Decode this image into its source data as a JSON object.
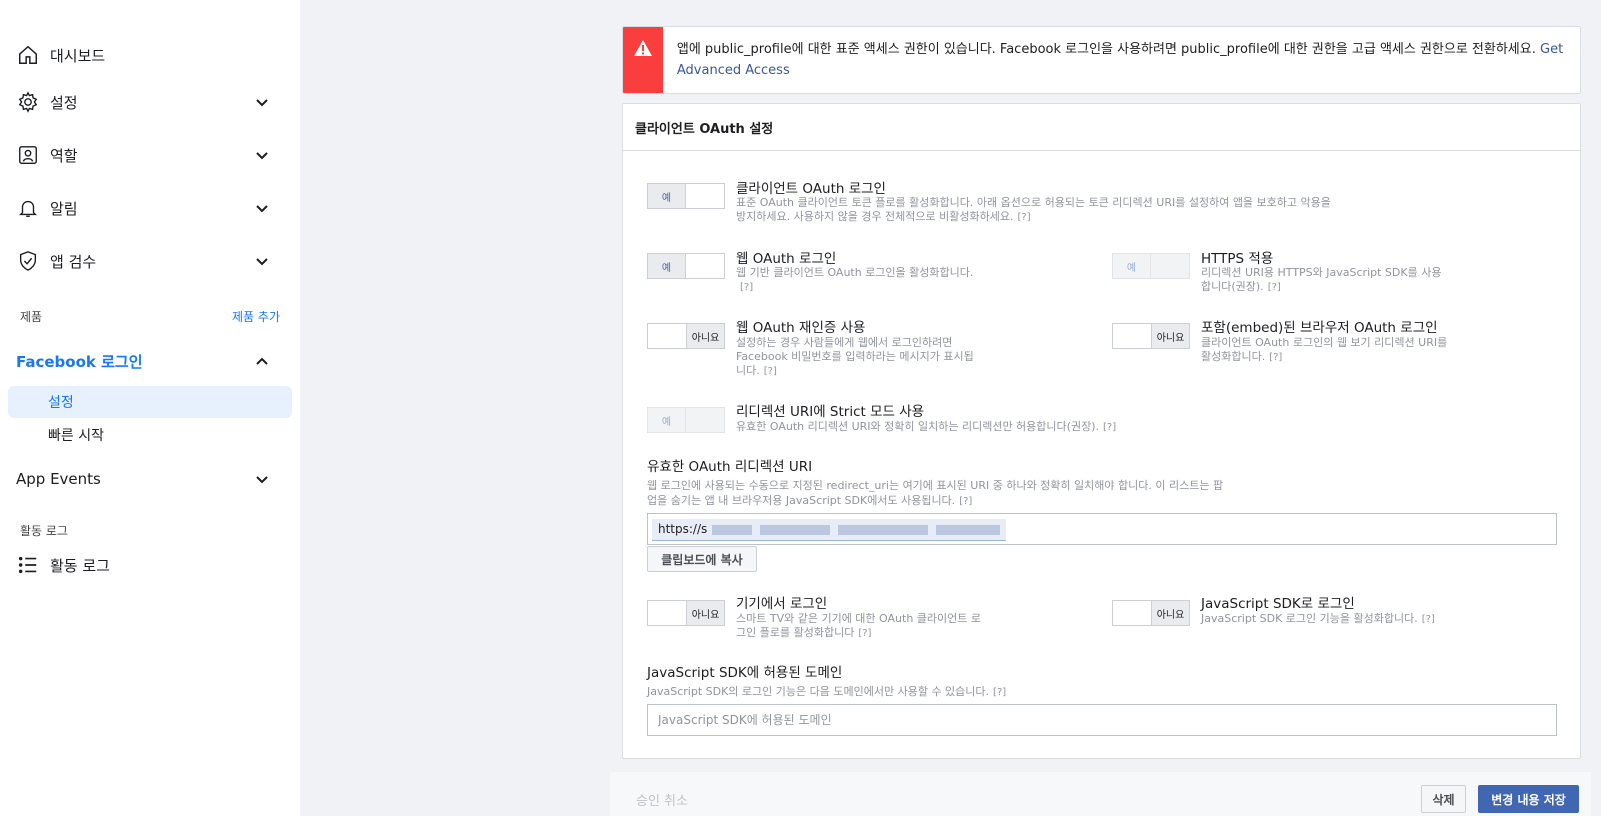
{
  "sidebar": {
    "items": [
      {
        "label": "대시보드",
        "icon": "home-icon"
      },
      {
        "label": "설정",
        "icon": "gear-icon"
      },
      {
        "label": "역할",
        "icon": "roles-icon"
      },
      {
        "label": "알림",
        "icon": "bell-icon"
      },
      {
        "label": "앱 검수",
        "icon": "shield-check-icon"
      }
    ],
    "products_label": "제품",
    "add_product_label": "제품 추가",
    "fb_login": {
      "label": "Facebook 로그인",
      "sub_items": [
        {
          "label": "설정",
          "active": true
        },
        {
          "label": "빠른 시작",
          "active": false
        }
      ]
    },
    "app_events_label": "App Events",
    "activity_section_label": "활동 로그",
    "activity_item_label": "활동 로그"
  },
  "alert": {
    "message": "앱에 public_profile에 대한 표준 액세스 권한이 있습니다. Facebook 로그인을 사용하려면 public_profile에 대한 권한을 고급 액세스 권한으로 전환하세요.",
    "link": "Get Advanced Access",
    "color": "#fa3e3e"
  },
  "panel": {
    "title": "클라이언트 OAuth 설정",
    "settings": {
      "client_oauth": {
        "title": "클라이언트 OAuth 로그인",
        "desc": "표준 OAuth 클라이언트 토큰 플로를 활성화합니다. 아래 옵션으로 허용되는 토큰 리디렉션 URI를 설정하여 앱을 보호하고 악용을 방지하세요. 사용하지 않을 경우 전체적으로 비활성화하세요.",
        "state": "예"
      },
      "web_oauth": {
        "title": "웹 OAuth 로그인",
        "desc": "웹 기반 클라이언트 OAuth 로그인을 활성화합니다.",
        "state": "예"
      },
      "https": {
        "title": "HTTPS 적용",
        "desc": "리디렉션 URI용 HTTPS와 JavaScript SDK를 사용합니다(권장).",
        "state": "예"
      },
      "reauth": {
        "title": "웹 OAuth 재인증 사용",
        "desc": "설정하는 경우 사람들에게 웹에서 로그인하려면 Facebook 비밀번호를 입력하라는 메시지가 표시됩니다.",
        "state": "아니요"
      },
      "embedded": {
        "title": "포함(embed)된 브라우저 OAuth 로그인",
        "desc": "클라이언트 OAuth 로그인의 웹 보기 리디렉션 URI를 활성화합니다.",
        "state": "아니요"
      },
      "strict": {
        "title": "리디렉션 URI에 Strict 모드 사용",
        "desc": "유효한 OAuth 리디렉션 URI와 정확히 일치하는 리디렉션만 허용합니다(권장).",
        "state": "예"
      },
      "device": {
        "title": "기기에서 로그인",
        "desc": "스마트 TV와 같은 기기에 대한 OAuth 클라이언트 로그인 플로를 활성화합니다",
        "state": "아니요"
      },
      "jssdk": {
        "title": "JavaScript SDK로 로그인",
        "desc": "JavaScript SDK 로그인 기능을 활성화합니다.",
        "state": "아니요"
      }
    },
    "redirect_uri": {
      "title": "유효한 OAuth 리디렉션 URI",
      "desc": "웹 로그인에 사용되는 수동으로 지정된 redirect_uri는 여기에 표시된 URI 중 하나와 정확히 일치해야 합니다. 이 리스트는 팝업을 숨기는 앱 내 브라우저용 JavaScript SDK에서도 사용됩니다.",
      "value": "https://s",
      "copy_button": "클립보드에 복사"
    },
    "sdk_domains": {
      "title": "JavaScript SDK에 허용된 도메인",
      "desc": "JavaScript SDK의 로그인 기능은 다음 도메인에서만 사용할 수 있습니다.",
      "placeholder": "JavaScript SDK에 허용된 도메인"
    },
    "help_mark": "[?]"
  },
  "footer": {
    "cancel_label": "승인 취소",
    "delete_label": "삭제",
    "save_label": "변경 내용 저장",
    "save_color": "#4267b2"
  }
}
